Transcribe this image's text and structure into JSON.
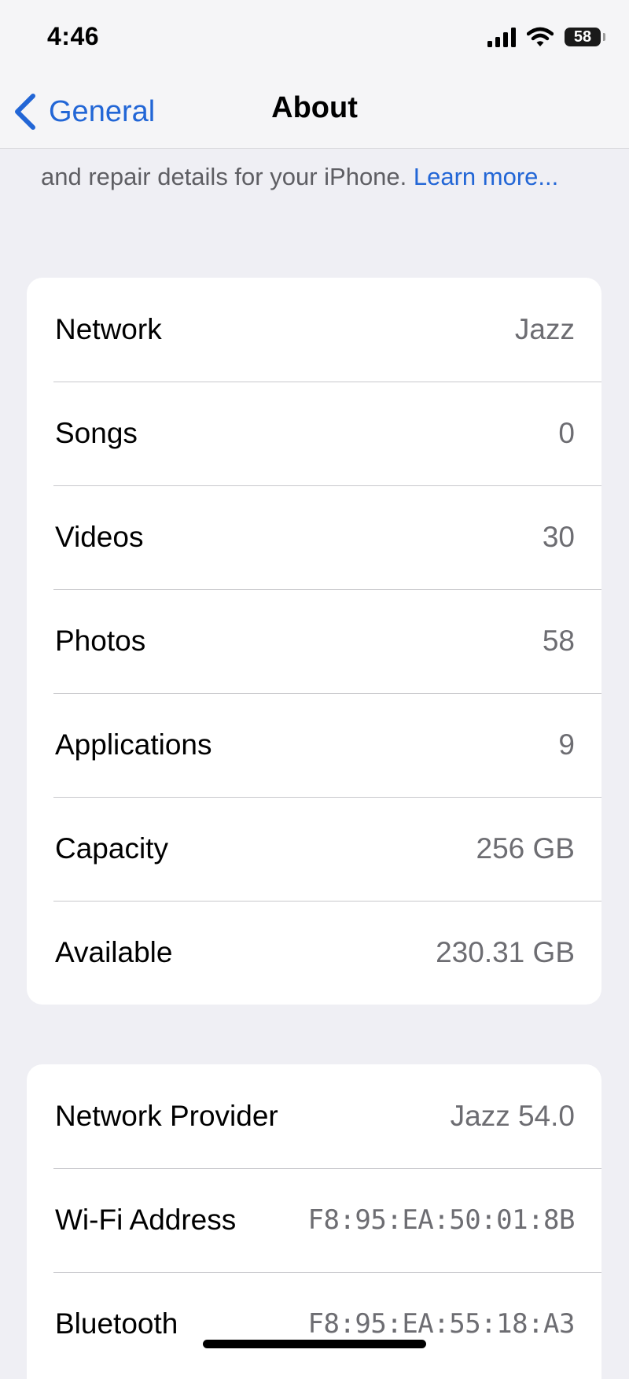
{
  "status_bar": {
    "time": "4:46",
    "battery_level": "58",
    "icons": [
      "cellular-signal-icon",
      "wifi-icon",
      "battery-icon"
    ]
  },
  "nav": {
    "back_label": "General",
    "title": "About",
    "back_icon": "chevron-left-icon"
  },
  "intro": {
    "text": "and repair details for your iPhone. ",
    "link": "Learn more..."
  },
  "colors": {
    "accent": "#2266d6",
    "background": "#efeff4",
    "card": "#ffffff",
    "secondary_text": "#6d6d72"
  },
  "info_group": [
    {
      "label": "Network",
      "value": "Jazz"
    },
    {
      "label": "Songs",
      "value": "0"
    },
    {
      "label": "Videos",
      "value": "30"
    },
    {
      "label": "Photos",
      "value": "58"
    },
    {
      "label": "Applications",
      "value": "9"
    },
    {
      "label": "Capacity",
      "value": "256 GB"
    },
    {
      "label": "Available",
      "value": "230.31 GB"
    }
  ],
  "network_group": [
    {
      "label": "Network Provider",
      "value": "Jazz 54.0"
    },
    {
      "label": "Wi-Fi Address",
      "value": "F8:95:EA:50:01:8B"
    },
    {
      "label": "Bluetooth",
      "value": "F8:95:EA:55:18:A3"
    }
  ]
}
